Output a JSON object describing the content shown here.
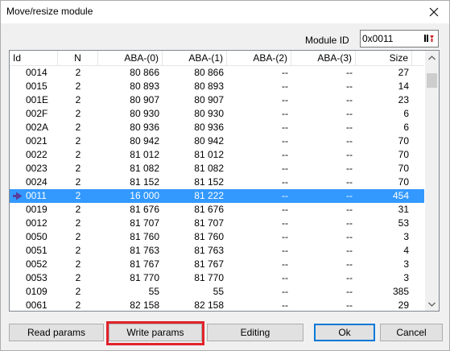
{
  "window": {
    "title": "Move/resize module"
  },
  "module_id": {
    "label": "Module ID",
    "value": "0x0011"
  },
  "columns": [
    "Id",
    "N",
    "ABA-(0)",
    "ABA-(1)",
    "ABA-(2)",
    "ABA-(3)",
    "Size"
  ],
  "rows": [
    {
      "id": "0014",
      "n": "2",
      "aba0": "80 866",
      "aba1": "80 866",
      "aba2": "--",
      "aba3": "--",
      "size": "27"
    },
    {
      "id": "0015",
      "n": "2",
      "aba0": "80 893",
      "aba1": "80 893",
      "aba2": "--",
      "aba3": "--",
      "size": "14"
    },
    {
      "id": "001E",
      "n": "2",
      "aba0": "80 907",
      "aba1": "80 907",
      "aba2": "--",
      "aba3": "--",
      "size": "23"
    },
    {
      "id": "002F",
      "n": "2",
      "aba0": "80 930",
      "aba1": "80 930",
      "aba2": "--",
      "aba3": "--",
      "size": "6"
    },
    {
      "id": "002A",
      "n": "2",
      "aba0": "80 936",
      "aba1": "80 936",
      "aba2": "--",
      "aba3": "--",
      "size": "6"
    },
    {
      "id": "0021",
      "n": "2",
      "aba0": "80 942",
      "aba1": "80 942",
      "aba2": "--",
      "aba3": "--",
      "size": "70"
    },
    {
      "id": "0022",
      "n": "2",
      "aba0": "81 012",
      "aba1": "81 012",
      "aba2": "--",
      "aba3": "--",
      "size": "70"
    },
    {
      "id": "0023",
      "n": "2",
      "aba0": "81 082",
      "aba1": "81 082",
      "aba2": "--",
      "aba3": "--",
      "size": "70"
    },
    {
      "id": "0024",
      "n": "2",
      "aba0": "81 152",
      "aba1": "81 152",
      "aba2": "--",
      "aba3": "--",
      "size": "70"
    },
    {
      "id": "0011",
      "n": "2",
      "aba0": "16 000",
      "aba1": "81 222",
      "aba2": "--",
      "aba3": "--",
      "size": "454",
      "selected": true
    },
    {
      "id": "0019",
      "n": "2",
      "aba0": "81 676",
      "aba1": "81 676",
      "aba2": "--",
      "aba3": "--",
      "size": "31"
    },
    {
      "id": "0012",
      "n": "2",
      "aba0": "81 707",
      "aba1": "81 707",
      "aba2": "--",
      "aba3": "--",
      "size": "53"
    },
    {
      "id": "0050",
      "n": "2",
      "aba0": "81 760",
      "aba1": "81 760",
      "aba2": "--",
      "aba3": "--",
      "size": "3"
    },
    {
      "id": "0051",
      "n": "2",
      "aba0": "81 763",
      "aba1": "81 763",
      "aba2": "--",
      "aba3": "--",
      "size": "4"
    },
    {
      "id": "0052",
      "n": "2",
      "aba0": "81 767",
      "aba1": "81 767",
      "aba2": "--",
      "aba3": "--",
      "size": "3"
    },
    {
      "id": "0053",
      "n": "2",
      "aba0": "81 770",
      "aba1": "81 770",
      "aba2": "--",
      "aba3": "--",
      "size": "3"
    },
    {
      "id": "0109",
      "n": "2",
      "aba0": "55",
      "aba1": "55",
      "aba2": "--",
      "aba3": "--",
      "size": "385"
    },
    {
      "id": "0061",
      "n": "2",
      "aba0": "82 158",
      "aba1": "82 158",
      "aba2": "--",
      "aba3": "--",
      "size": "29"
    }
  ],
  "buttons": {
    "read_params": "Read params",
    "write_params": "Write params",
    "editing": "Editing",
    "ok": "Ok",
    "cancel": "Cancel"
  },
  "icons": {
    "close": "close-icon",
    "module_picker": "module-picker-icon",
    "row_marker": "arrow-right-icon",
    "scroll_up": "scroll-up-icon",
    "scroll_down": "scroll-down-icon"
  },
  "colors": {
    "selection": "#3399ff",
    "highlight": "#e1232b",
    "marker": "#5a3d99"
  }
}
